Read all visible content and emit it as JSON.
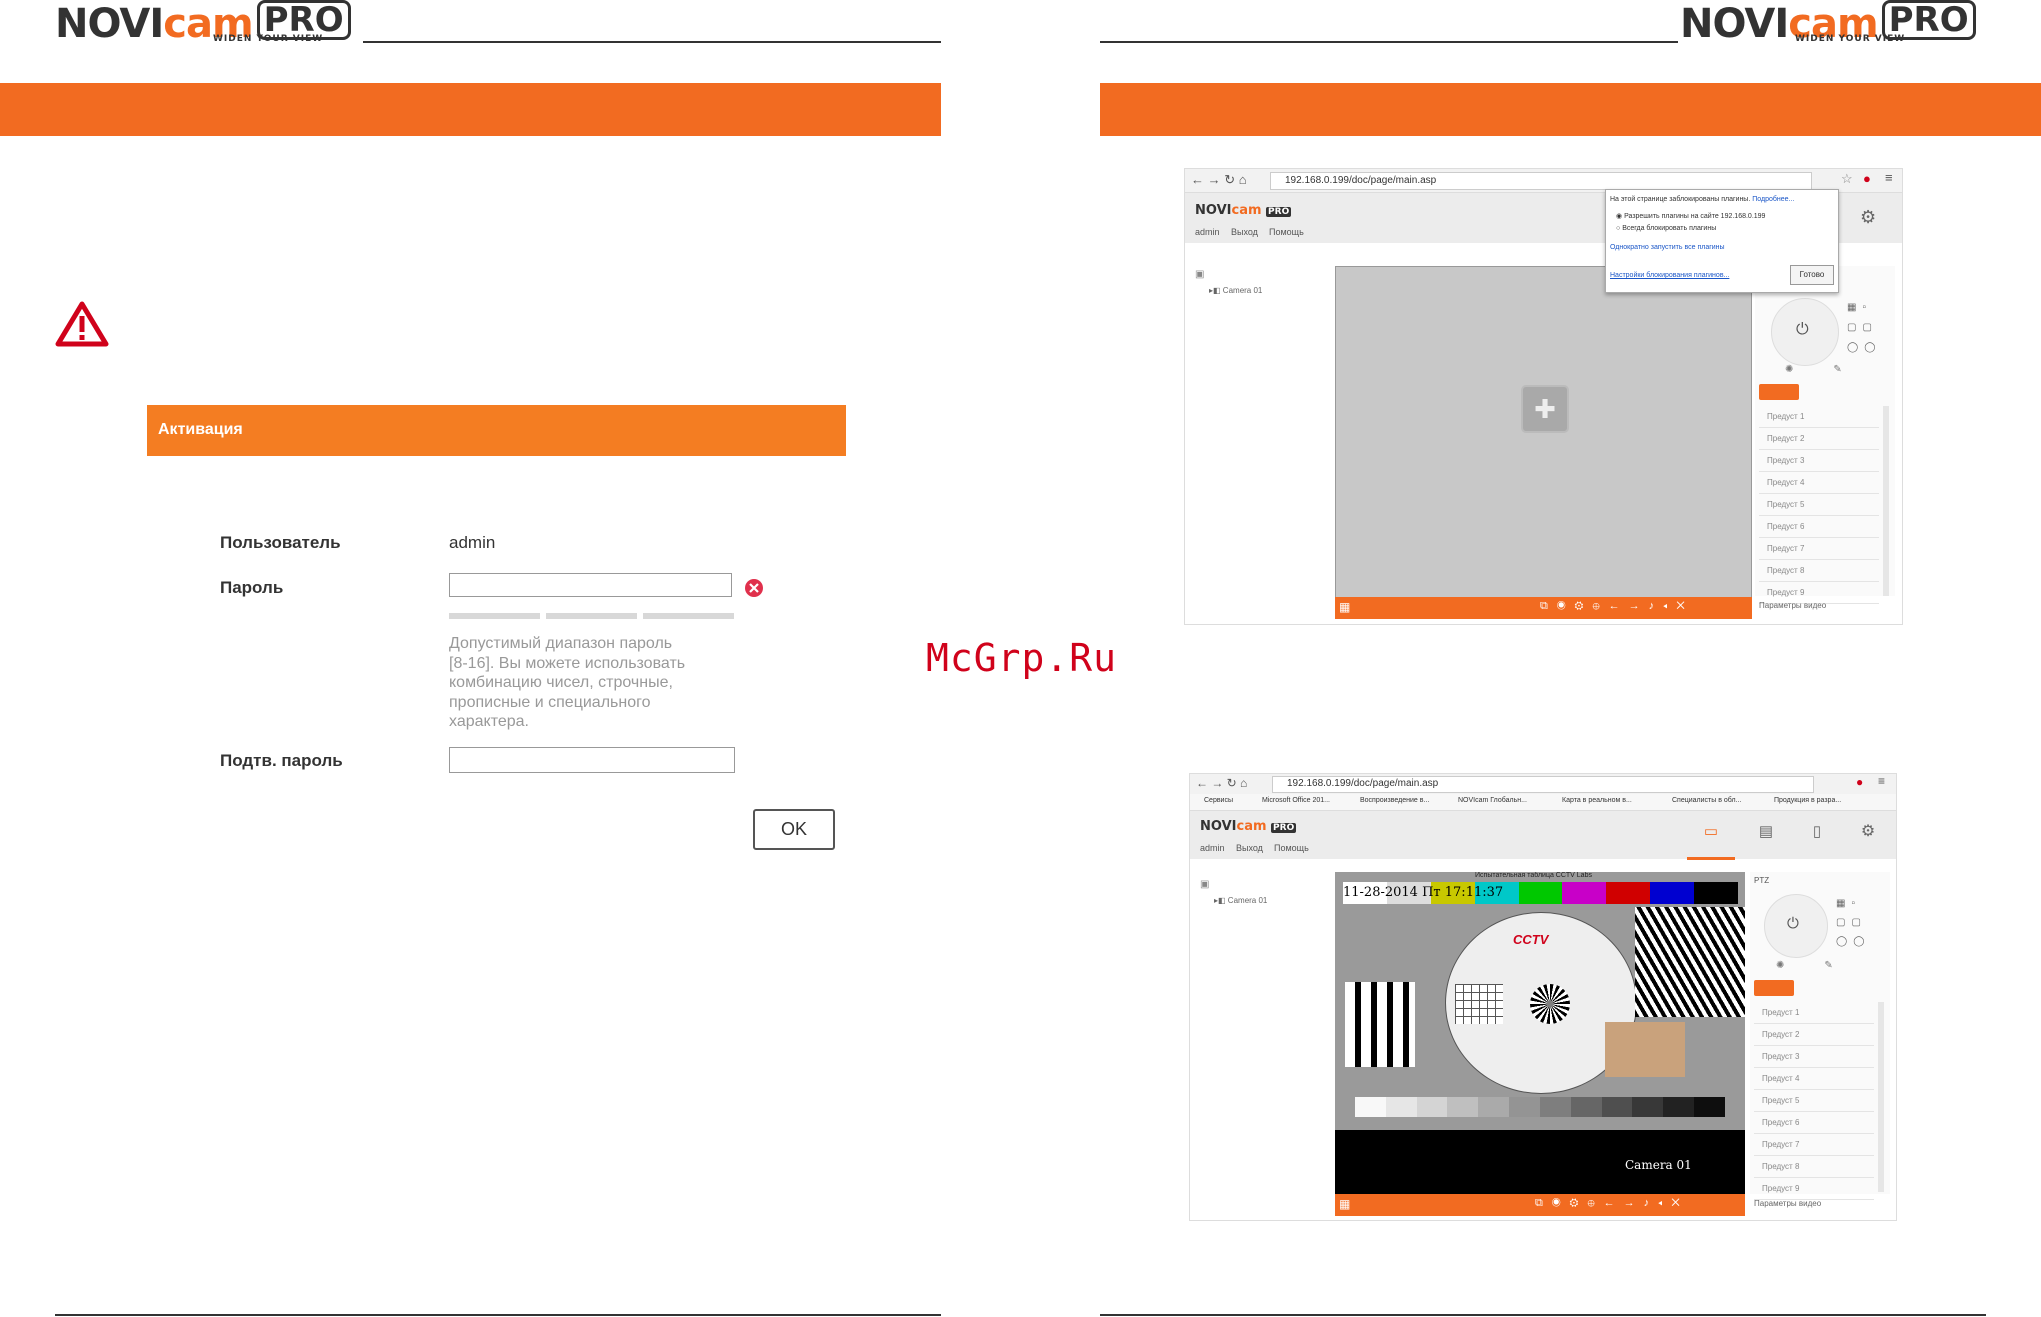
{
  "logo": {
    "text_a": "NOVI",
    "text_b": "cam",
    "pro": "PRO",
    "tagline": "WIDEN YOUR VIEW"
  },
  "watermark": "McGrp.Ru",
  "activation": {
    "header": "Активация",
    "user_label": "Пользователь",
    "user_value": "admin",
    "password_label": "Пароль",
    "password_value": "",
    "hint": [
      "Допустимый диапазон пароль",
      "[8-16]. Вы можете использовать",
      "комбинацию чисел, строчные,",
      "прописные и специального",
      "характера."
    ],
    "confirm_label": "Подтв. пароль",
    "confirm_value": "",
    "ok_label": "OK"
  },
  "browser1": {
    "url": "192.168.0.199/doc/page/main.asp",
    "menu": [
      "admin",
      "Выход",
      "Помощь"
    ],
    "camera": "Camera 01",
    "popup": {
      "title": "На этой странице заблокированы плагины.",
      "more": "Подробнее...",
      "opt1": "Разрешить плагины на сайте 192.168.0.199",
      "opt2": "Всегда блокировать плагины",
      "run_once": "Однократно запустить все плагины",
      "settings": "Настройки блокирования плагинов...",
      "done": "Готово"
    },
    "presets": [
      "Предуст 1",
      "Предуст 2",
      "Предуст 3",
      "Предуст 4",
      "Предуст 5",
      "Предуст 6",
      "Предуст 7",
      "Предуст 8",
      "Предуст 9"
    ],
    "video_params": "Параметры видео"
  },
  "browser2": {
    "url": "192.168.0.199/doc/page/main.asp",
    "bookmarks": [
      "Сервисы",
      "Microsoft Office 201...",
      "Воспроизведение в...",
      "NOVIcam Глобальн...",
      "Карта в реальном в...",
      "Специалисты в обл...",
      "Продукция в разра..."
    ],
    "menu": [
      "admin",
      "Выход",
      "Помощь"
    ],
    "camera": "Camera 01",
    "ptz": "PTZ",
    "osd_date": "11-28-2014",
    "osd_day": "Пт",
    "osd_time": "17:11:37",
    "test_title": "Испытательная таблица CCTV Labs",
    "chart_brand": "CCTV",
    "osd_camera": "Camera 01",
    "presets": [
      "Предуст 1",
      "Предуст 2",
      "Предуст 3",
      "Предуст 4",
      "Предуст 5",
      "Предуст 6",
      "Предуст 7",
      "Предуст 8",
      "Предуст 9"
    ],
    "video_params": "Параметры видео"
  },
  "colors": {
    "accent": "#f26b21",
    "dark": "#333333"
  }
}
